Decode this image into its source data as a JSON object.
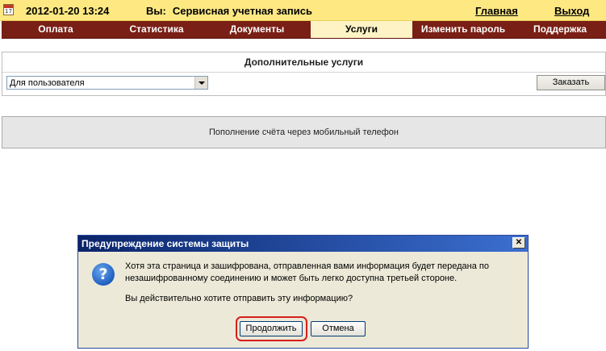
{
  "header": {
    "calendar_day": "17",
    "datetime": "2012-01-20 13:24",
    "you_label": "Вы:",
    "account_name": "Сервисная учетная запись",
    "home_link": "Главная",
    "logout_link": "Выход"
  },
  "nav": {
    "tabs": [
      {
        "label": "Оплата",
        "active": false
      },
      {
        "label": "Статистика",
        "active": false
      },
      {
        "label": "Документы",
        "active": false
      },
      {
        "label": "Услуги",
        "active": true
      },
      {
        "label": "Изменить пароль",
        "active": false
      },
      {
        "label": "Поддержка",
        "active": false
      }
    ]
  },
  "services": {
    "title": "Дополнительные услуги",
    "select_value": "Для пользователя",
    "order_button": "Заказать"
  },
  "topup": {
    "label": "Пополнение счёта через мобильный телефон"
  },
  "dialog": {
    "title": "Предупреждение системы защиты",
    "close_glyph": "✕",
    "icon_glyph": "?",
    "message_line1": "Хотя эта страница и зашифрована, отправленная вами информация будет передана по",
    "message_line2": "незашифрованному соединению и может быть легко доступна третьей стороне.",
    "question": "Вы действительно хотите отправить эту информацию?",
    "continue_button": "Продолжить",
    "cancel_button": "Отмена"
  },
  "colors": {
    "topbar_bg": "#fde882",
    "nav_bg": "#7a1f15",
    "nav_active_bg": "#fdf3c4",
    "dialog_bg": "#ece9d8",
    "highlight": "#d81e1e"
  },
  "icons": [
    "calendar-icon",
    "question-icon",
    "close-icon",
    "dropdown-arrow-icon"
  ]
}
